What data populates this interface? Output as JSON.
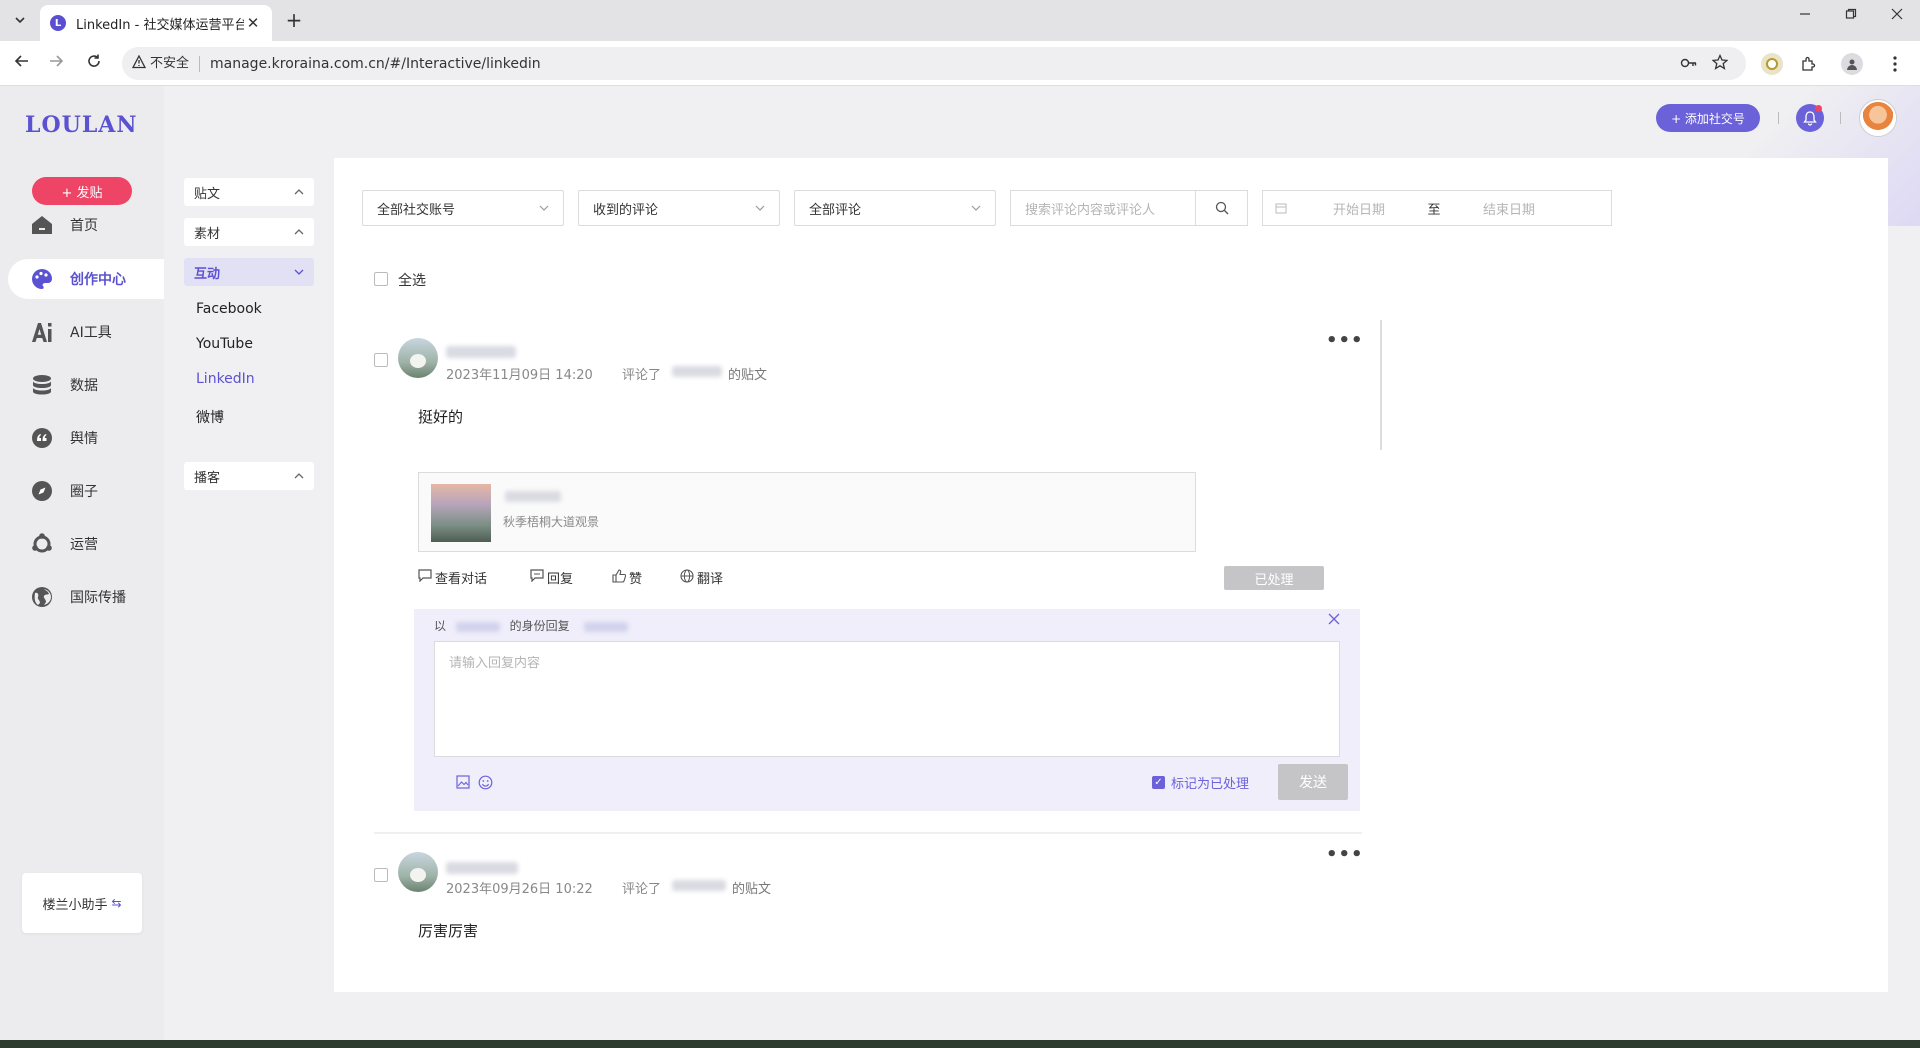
{
  "browser": {
    "tab_title": "LinkedIn - 社交媒体运营平台",
    "new_tab_symbol": "+",
    "close_symbol": "✕",
    "not_secure_label": "不安全",
    "url": "manage.kroraina.com.cn/#/Interactive/linkedin"
  },
  "app": {
    "logo": "LOULAN",
    "post_button": "+ 发贴",
    "nav": [
      {
        "label": "首页",
        "icon": "home-icon"
      },
      {
        "label": "创作中心",
        "icon": "palette-icon"
      },
      {
        "label": "AI工具",
        "icon": "ai-icon"
      },
      {
        "label": "数据",
        "icon": "database-icon"
      },
      {
        "label": "舆情",
        "icon": "quote-icon"
      },
      {
        "label": "圈子",
        "icon": "compass-icon"
      },
      {
        "label": "运营",
        "icon": "operations-icon"
      },
      {
        "label": "国际传播",
        "icon": "globe-icon"
      }
    ],
    "assistant_label": "楼兰小助手",
    "accent_color": "#5b52d1",
    "danger_color": "#ee4466"
  },
  "subnav": {
    "groups": [
      {
        "label": "贴文"
      },
      {
        "label": "素材"
      },
      {
        "label": "互动"
      },
      {
        "label": "播客"
      }
    ],
    "items": [
      {
        "label": "Facebook"
      },
      {
        "label": "YouTube"
      },
      {
        "label": "LinkedIn"
      },
      {
        "label": "微博"
      }
    ]
  },
  "header": {
    "add_account_label": "+ 添加社交号"
  },
  "filters": {
    "account": "全部社交账号",
    "comment_type": "收到的评论",
    "comment_scope": "全部评论",
    "search_placeholder": "搜索评论内容或评论人",
    "start_date_placeholder": "开始日期",
    "date_separator": "至",
    "end_date_placeholder": "结束日期",
    "select_all_label": "全选"
  },
  "comments": [
    {
      "timestamp": "2023年11月09日 14:20",
      "commented_prefix": "评论了",
      "commented_suffix": "的贴文",
      "text": "挺好的",
      "post_desc": "秋季梧桐大道观景",
      "actions": {
        "view": "查看对话",
        "reply": "回复",
        "like": "赞",
        "translate": "翻译"
      },
      "status_button": "已处理",
      "reply": {
        "prefix": "以",
        "suffix": "的身份回复",
        "placeholder": "请输入回复内容",
        "mark_done_label": "标记为已处理",
        "send_label": "发送"
      }
    },
    {
      "timestamp": "2023年09月26日 10:22",
      "commented_prefix": "评论了",
      "commented_suffix": "的贴文",
      "text": "厉害厉害"
    }
  ]
}
